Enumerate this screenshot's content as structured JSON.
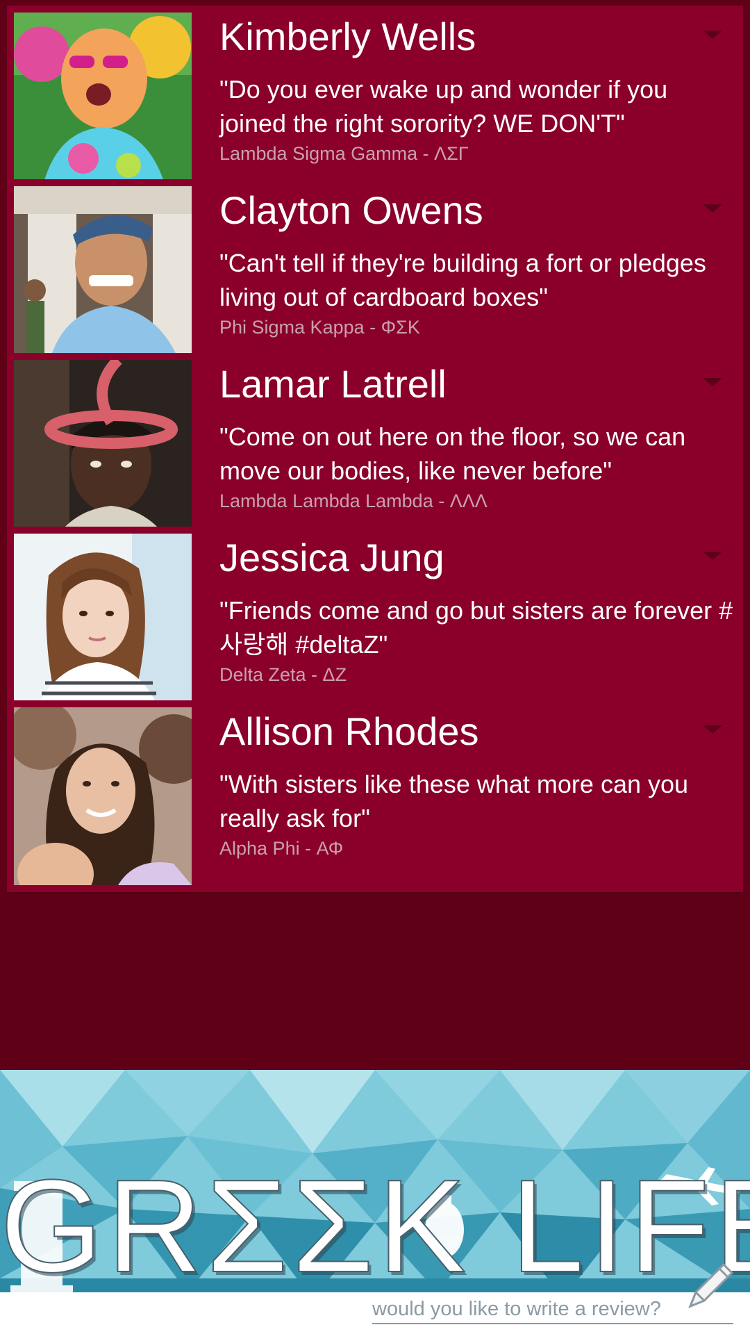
{
  "posts": [
    {
      "name": "Kimberly Wells",
      "quote": "\"Do you ever wake up and wonder if you joined the right sorority? WE DON'T\"",
      "org": "Lambda Sigma Gamma - ΛΣΓ"
    },
    {
      "name": "Clayton Owens",
      "quote": "\"Can't tell if they're building a fort or pledges living out of cardboard boxes\"",
      "org": "Phi Sigma Kappa - ΦΣΚ"
    },
    {
      "name": "Lamar Latrell",
      "quote": "\"Come on out here on the floor, so we can move our bodies, like never before\"",
      "org": "Lambda Lambda Lambda - ΛΛΛ"
    },
    {
      "name": "Jessica Jung",
      "quote": "\"Friends come and go but sisters are forever #사랑해 #deltaZ\"",
      "org": "Delta Zeta - ΔΖ"
    },
    {
      "name": "Allison Rhodes",
      "quote": "\"With sisters like these what more can you really ask for\"",
      "org": "Alpha Phi - ΑΦ"
    }
  ],
  "banner": {
    "logo": "GRΣΣK LIFE",
    "review_prompt": "would you like to write a review?"
  },
  "colors": {
    "card": "#8b002b",
    "background": "#5f0016",
    "banner": "#3aa3b8"
  }
}
